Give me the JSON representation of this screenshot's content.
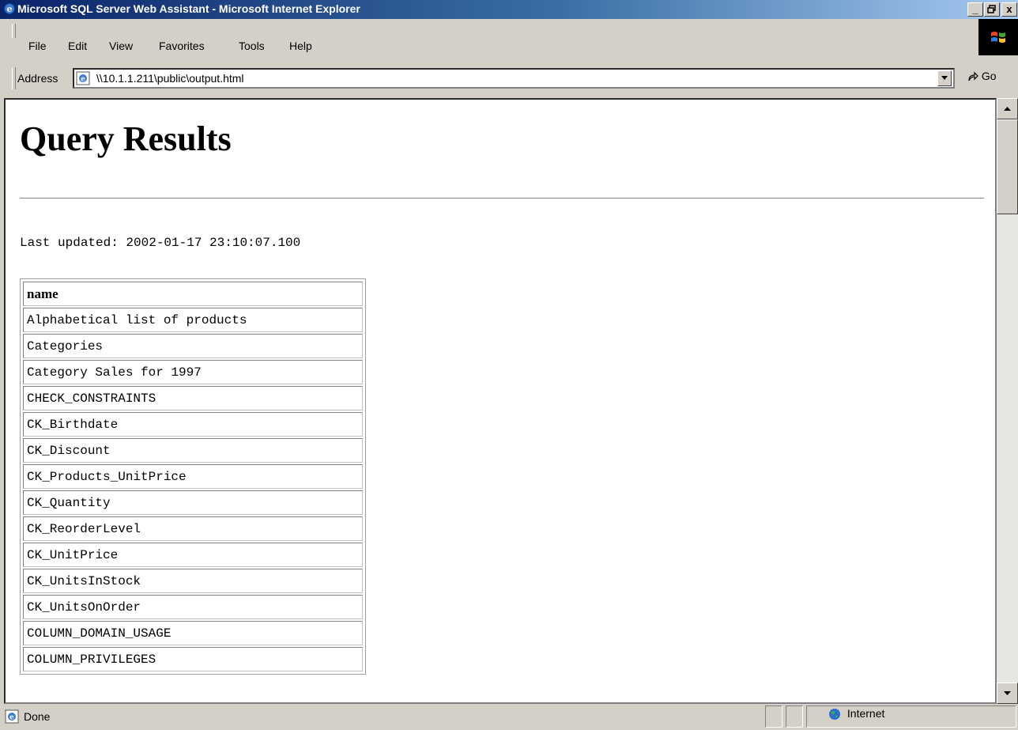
{
  "window": {
    "title": "Microsoft SQL Server Web Assistant - Microsoft Internet Explorer",
    "minimize": "_",
    "maximize": "▫",
    "close": "x"
  },
  "menu": [
    "File",
    "Edit",
    "View",
    "Favorites",
    "Tools",
    "Help"
  ],
  "address": {
    "label": "Address",
    "value": "\\\\10.1.1.211\\public\\output.html",
    "go": "Go"
  },
  "page": {
    "heading": "Query Results",
    "updated": "Last updated: 2002-01-17 23:10:07.100",
    "table": {
      "header": "name",
      "rows": [
        "Alphabetical list of products",
        "Categories",
        "Category Sales for 1997",
        "CHECK_CONSTRAINTS",
        "CK_Birthdate",
        "CK_Discount",
        "CK_Products_UnitPrice",
        "CK_Quantity",
        "CK_ReorderLevel",
        "CK_UnitPrice",
        "CK_UnitsInStock",
        "CK_UnitsOnOrder",
        "COLUMN_DOMAIN_USAGE",
        "COLUMN_PRIVILEGES"
      ]
    }
  },
  "status": {
    "text": "Done",
    "zone": "Internet"
  },
  "colors": {
    "titlebar_start": "#0a246a",
    "titlebar_end": "#a6caf0",
    "chrome": "#d4d0c8"
  }
}
